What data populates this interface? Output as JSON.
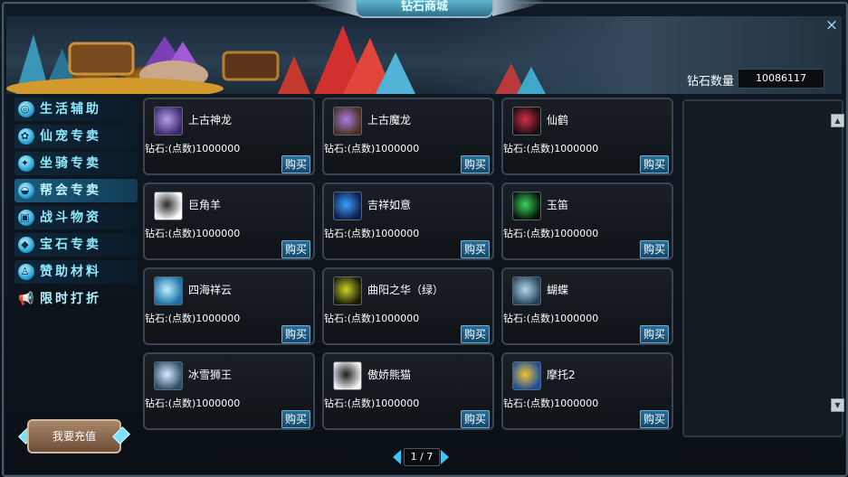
{
  "window": {
    "title": "钻石商城",
    "close_symbol": "×"
  },
  "header": {
    "diamond_label": "钻石数量",
    "diamond_value": "10086117"
  },
  "sidebar": {
    "categories": [
      {
        "label": "生活辅助",
        "icon": "life-icon",
        "glyph": "◎"
      },
      {
        "label": "仙宠专卖",
        "icon": "paw-icon",
        "glyph": "✿"
      },
      {
        "label": "坐骑专卖",
        "icon": "mount-icon",
        "glyph": "✦"
      },
      {
        "label": "帮会专卖",
        "icon": "guild-icon",
        "glyph": "◒"
      },
      {
        "label": "战斗物资",
        "icon": "battle-icon",
        "glyph": "▣"
      },
      {
        "label": "宝石专卖",
        "icon": "gem-icon",
        "glyph": "◆"
      },
      {
        "label": "赞助材料",
        "icon": "sponsor-icon",
        "glyph": "♙"
      },
      {
        "label": "限时打折",
        "icon": "megaphone-icon",
        "glyph": "📢"
      }
    ],
    "active_index": 3,
    "recharge_label": "我要充值"
  },
  "items": [
    {
      "name": "上古神龙",
      "price": "钻石:(点数)1000000",
      "buy": "购买",
      "icon": "dragon-icon",
      "colors": [
        "#3b2a6b",
        "#b6a0e6"
      ]
    },
    {
      "name": "上古魔龙",
      "price": "钻石:(点数)1000000",
      "buy": "购买",
      "icon": "demon-dragon-icon",
      "colors": [
        "#4a2f22",
        "#a97de0"
      ]
    },
    {
      "name": "仙鹤",
      "price": "钻石:(点数)1000000",
      "buy": "购买",
      "icon": "crane-icon",
      "colors": [
        "#1a0b0e",
        "#d0304a"
      ]
    },
    {
      "name": "巨角羊",
      "price": "钻石:(点数)1000000",
      "buy": "购买",
      "icon": "ram-icon",
      "colors": [
        "#ffffff",
        "#2a2a2a"
      ]
    },
    {
      "name": "吉祥如意",
      "price": "钻石:(点数)1000000",
      "buy": "购买",
      "icon": "ruyi-icon",
      "colors": [
        "#0f1d4a",
        "#3aa0ff"
      ]
    },
    {
      "name": "玉笛",
      "price": "钻石:(点数)1000000",
      "buy": "购买",
      "icon": "jade-flute-icon",
      "colors": [
        "#06120a",
        "#3bd45a"
      ]
    },
    {
      "name": "四海祥云",
      "price": "钻石:(点数)1000000",
      "buy": "购买",
      "icon": "cloud-icon",
      "colors": [
        "#1a6fa6",
        "#bff0ff"
      ]
    },
    {
      "name": "曲阳之华（绿）",
      "price": "钻石:(点数)1000000",
      "buy": "购买",
      "icon": "green-blade-icon",
      "colors": [
        "#1a1a06",
        "#c9d22a"
      ]
    },
    {
      "name": "蝴蝶",
      "price": "钻石:(点数)1000000",
      "buy": "购买",
      "icon": "butterfly-icon",
      "colors": [
        "#27435a",
        "#b4d8ec"
      ]
    },
    {
      "name": "冰雪狮王",
      "price": "钻石:(点数)1000000",
      "buy": "购买",
      "icon": "ice-lion-icon",
      "colors": [
        "#2f4d66",
        "#d6ecff"
      ]
    },
    {
      "name": "傲娇熊猫",
      "price": "钻石:(点数)1000000",
      "buy": "购买",
      "icon": "panda-icon",
      "colors": [
        "#f2f2f2",
        "#1b1b1b"
      ]
    },
    {
      "name": "摩托2",
      "price": "钻石:(点数)1000000",
      "buy": "购买",
      "icon": "motorbike-icon",
      "colors": [
        "#1e4f9a",
        "#f1c232"
      ]
    }
  ],
  "pagination": {
    "current": "1",
    "total": "7",
    "text": "1 / 7"
  },
  "scroll": {
    "up_symbol": "▲",
    "down_symbol": "▼"
  }
}
